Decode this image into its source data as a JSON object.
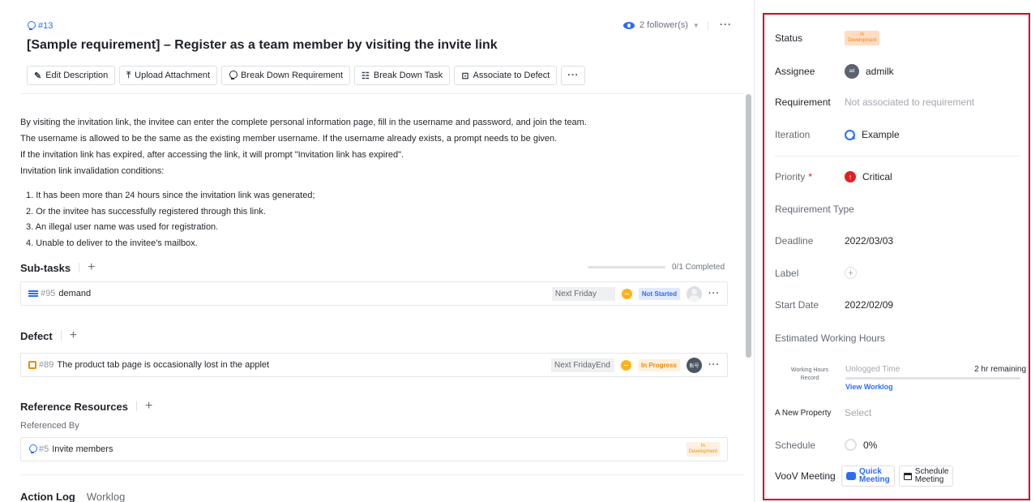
{
  "requirement": {
    "id": "#13",
    "title": "[Sample requirement] – Register as a team member by visiting the invite link",
    "followers": "2 follower(s)"
  },
  "toolbar": {
    "edit_description": "Edit Description",
    "upload_attachment": "Upload Attachment",
    "break_down_requirement": "Break Down Requirement",
    "break_down_task": "Break Down Task",
    "associate_to_defect": "Associate to Defect",
    "more": "···"
  },
  "description": {
    "lines": [
      "By visiting the invitation link, the invitee can enter the complete personal information page, fill in the username and password, and join the team.",
      "The username is allowed to be the same as the existing member username. If the username already exists, a prompt needs to be given.",
      "If the invitation link has expired, after accessing the link, it will prompt \"Invitation link has expired\".",
      "Invitation link invalidation conditions:"
    ],
    "conditions": [
      "1. It has been more than 24 hours since the invitation link was generated;",
      "2. Or the invitee has successfully registered through this link.",
      "3. An illegal user name was used for registration.",
      "4. Unable to deliver to the invitee's mailbox."
    ]
  },
  "subtasks": {
    "heading": "Sub-tasks",
    "progress_text": "0/1 Completed",
    "progress_fraction": 0,
    "items": [
      {
        "id": "#95",
        "title": "demand",
        "date": "Next Friday",
        "status": "Not Started"
      }
    ]
  },
  "defects": {
    "heading": "Defect",
    "items": [
      {
        "id": "#89",
        "title": "The product tab page is occasionally lost in the applet",
        "date": "Next FridayEnd",
        "status": "In Progress",
        "avatar": "账号"
      }
    ]
  },
  "references": {
    "heading": "Reference Resources",
    "sub_label": "Referenced By",
    "items": [
      {
        "id": "#5",
        "title": "Invite members",
        "status_line1": "In",
        "status_line2": "Development"
      }
    ]
  },
  "tabs": [
    "Action Log",
    "Worklog"
  ],
  "panel": {
    "status_label": "Status",
    "status_line1": "In",
    "status_line2": "Development",
    "assignee_label": "Assignee",
    "assignee_initials": "ad",
    "assignee_name": "admilk",
    "requirement_label": "Requirement",
    "requirement_value": "Not associated to requirement",
    "iteration_label": "Iteration",
    "iteration_value": "Example",
    "priority_label": "Priority",
    "priority_star": "*",
    "priority_value": "Critical",
    "requirement_type_label": "Requirement Type",
    "deadline_label": "Deadline",
    "deadline_value": "2022/03/03",
    "label_label": "Label",
    "start_date_label": "Start Date",
    "start_date_value": "2022/02/09",
    "estimated_hours_label": "Estimated Working Hours",
    "working_hours_record_line1": "Working Hours",
    "working_hours_record_line2": "Record",
    "unlogged_time": "Unlogged Time",
    "remaining": "2 hr remaining",
    "view_worklog": "View Worklog",
    "new_property_label": "A New Property",
    "new_property_value": "Select",
    "schedule_label": "Schedule",
    "schedule_value": "0%",
    "voov_label": "VooV Meeting",
    "quick_meeting_line1": "Quick",
    "quick_meeting_line2": "Meeting",
    "schedule_meeting_line1": "Schedule",
    "schedule_meeting_line2": "Meeting"
  },
  "colors": {
    "accent": "#2c6df6",
    "highlight_border": "#d0021b",
    "in_development": "#f08a00",
    "critical": "#e02020"
  }
}
